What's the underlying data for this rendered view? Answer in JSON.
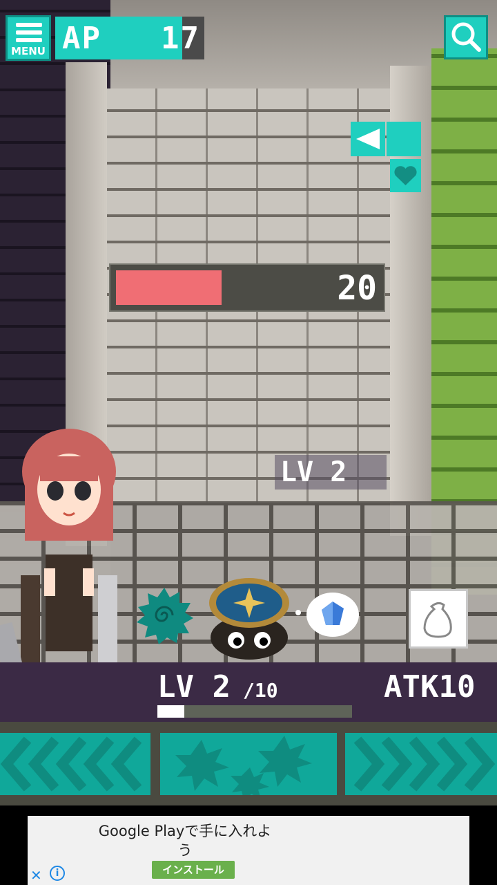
{
  "hud": {
    "menu_label": "MENU",
    "ap_label": "AP",
    "ap_value": "17",
    "ap_fill_fraction": 0.85
  },
  "enemy": {
    "hp_value": "20",
    "hp_fill_fraction": 0.51,
    "level_text": "LV 2"
  },
  "player": {
    "level_label": "LV  2",
    "level_max": "/10",
    "attack": "ATK10",
    "xp_fraction": 0.14
  },
  "ad": {
    "headline": "Google Playで手に入れよう",
    "install_label": "インストール",
    "close_glyph": "✕",
    "info_glyph": "i"
  },
  "colors": {
    "accent": "#1fcfbf",
    "hp": "#f06e74",
    "status_bg": "#3b2a45"
  },
  "icons": [
    "menu-icon",
    "search-icon",
    "back-arrow-icon",
    "heart-icon",
    "spiral-icon",
    "compass-icon",
    "gem-icon",
    "bag-icon"
  ]
}
